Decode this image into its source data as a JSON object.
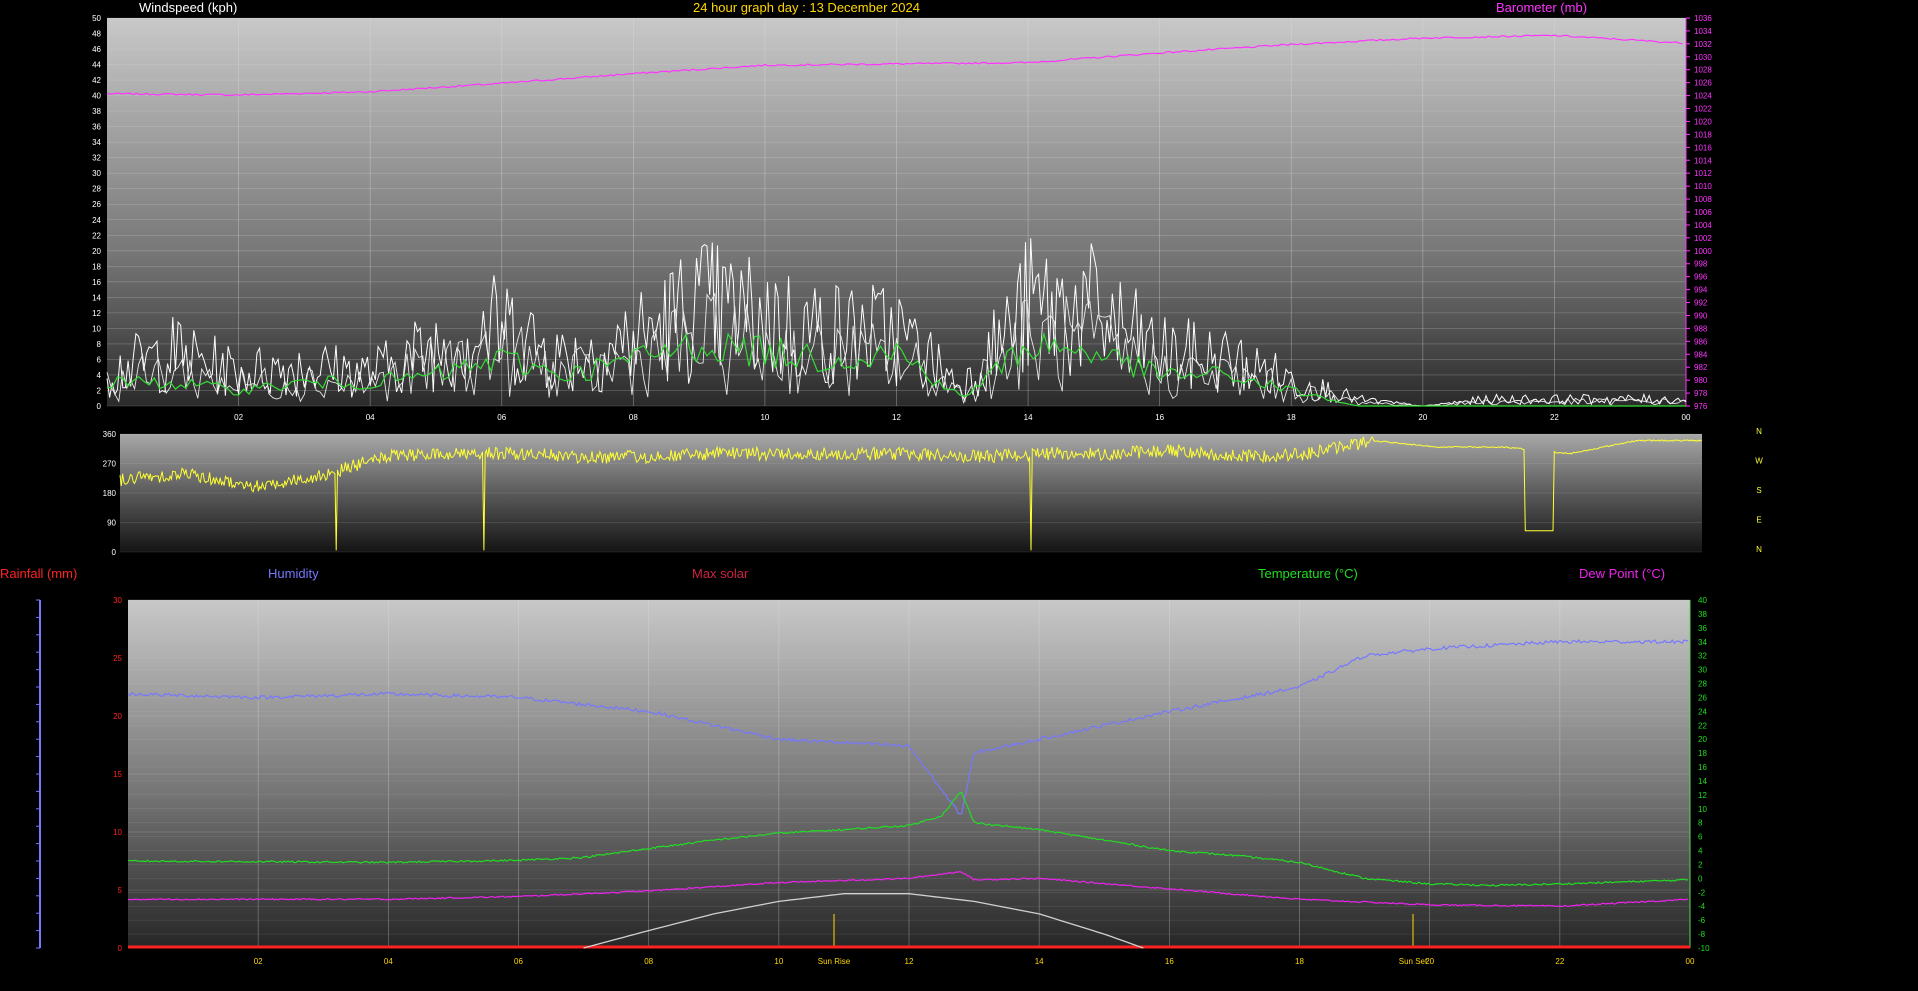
{
  "header": {
    "title": "24 hour graph day : 13 December 2024",
    "wind_label": "Windspeed (kph)",
    "baro_label": "Barometer (mb)"
  },
  "legend": {
    "rainfall": "Rainfall (mm)",
    "humidity": "Humidity",
    "max_solar": "Max solar",
    "temperature": "Temperature (°C)",
    "dew_point": "Dew Point (°C)"
  },
  "annotations": {
    "sun_rise": "Sun Rise",
    "sun_set": "Sun Set"
  },
  "colors": {
    "title": "#ffd700",
    "wind_gust": "#ffffff",
    "wind_avg": "#33dd33",
    "barometer": "#ff33ff",
    "wind_dir": "#ffff33",
    "rain": "#ff2222",
    "humidity": "#7777ff",
    "max_solar": "#cc2244",
    "temperature": "#22dd22",
    "dew_point": "#ee22ee",
    "solar_curve": "#d0d0d0"
  },
  "chart_data": [
    {
      "type": "line",
      "name": "wind-barometer",
      "x_ticks": [
        "02",
        "04",
        "06",
        "08",
        "10",
        "12",
        "14",
        "16",
        "18",
        "20",
        "22",
        "00"
      ],
      "y_left": {
        "label": "Windspeed (kph)",
        "min": 0,
        "max": 50,
        "step": 2
      },
      "y_right": {
        "label": "Barometer (mb)",
        "min": 976,
        "max": 1036,
        "step": 2
      },
      "series": [
        {
          "name": "Barometer (mb)",
          "axis": "right",
          "x": [
            0,
            2,
            4,
            6,
            8,
            10,
            12,
            14,
            16,
            18,
            20,
            22,
            24
          ],
          "values": [
            1024.3,
            1024.1,
            1024.6,
            1025.9,
            1027.4,
            1028.7,
            1028.9,
            1029.1,
            1030.6,
            1031.9,
            1032.9,
            1033.3,
            1032.1
          ]
        },
        {
          "name": "Windspeed (kph)",
          "axis": "left",
          "x": [
            0,
            1,
            2,
            3,
            4,
            5,
            6,
            7,
            8,
            9,
            10,
            11,
            12,
            13,
            14,
            15,
            16,
            17,
            18,
            19,
            20,
            21,
            22,
            23,
            24
          ],
          "values": [
            5,
            8,
            5,
            6,
            5,
            9,
            12,
            7,
            10,
            15,
            13,
            11,
            11,
            3,
            15,
            14,
            8,
            7,
            4,
            1,
            0,
            1,
            1,
            1,
            1
          ]
        },
        {
          "name": "Average windspeed",
          "axis": "left",
          "x": [
            0,
            1,
            2,
            3,
            4,
            5,
            6,
            7,
            8,
            9,
            10,
            11,
            12,
            13,
            14,
            15,
            16,
            17,
            18,
            19,
            20,
            21,
            22,
            23,
            24
          ],
          "values": [
            3,
            3,
            2,
            3,
            3,
            4,
            6,
            4,
            6,
            8,
            7,
            6,
            7,
            1,
            8,
            7,
            4,
            4,
            2,
            0,
            0,
            0,
            0,
            0,
            0
          ]
        }
      ]
    },
    {
      "type": "line",
      "name": "wind-direction",
      "x_ticks": [
        "02",
        "04",
        "06",
        "08",
        "10",
        "12",
        "14",
        "16",
        "18",
        "20",
        "22",
        "00"
      ],
      "y_ticks": [
        0,
        90,
        180,
        270,
        360
      ],
      "compass": [
        "N",
        "W",
        "S",
        "E",
        "N"
      ],
      "series": [
        {
          "name": "Wind direction",
          "x": [
            0,
            1,
            2,
            3,
            4,
            5,
            6,
            7,
            8,
            9,
            10,
            11,
            12,
            13,
            14,
            15,
            16,
            17,
            18,
            19,
            20,
            21,
            22,
            23,
            24
          ],
          "values": [
            220,
            240,
            200,
            230,
            290,
            300,
            300,
            290,
            290,
            300,
            300,
            300,
            300,
            290,
            300,
            300,
            310,
            290,
            300,
            340,
            320,
            320,
            300,
            340,
            340
          ]
        }
      ]
    },
    {
      "type": "line",
      "name": "temperature-humidity",
      "x_ticks": [
        "02",
        "04",
        "06",
        "08",
        "10",
        "12",
        "14",
        "16",
        "18",
        "20",
        "22",
        "00"
      ],
      "y_rain": {
        "label": "Rainfall (mm)",
        "min": 0,
        "max": 30,
        "ticks": [
          0,
          5,
          10,
          15,
          20,
          25,
          30
        ]
      },
      "y_temp": {
        "label": "Temperature (°C)",
        "min": -10,
        "max": 40,
        "step": 2
      },
      "series": [
        {
          "name": "Humidity",
          "axis": "temp",
          "x": [
            0,
            2,
            4,
            6,
            8,
            10,
            12,
            12.8,
            13,
            14,
            16,
            18,
            19,
            20,
            22,
            24
          ],
          "values": [
            26.5,
            26,
            26.5,
            26,
            24,
            20,
            19,
            9,
            18,
            20,
            24,
            27.5,
            32,
            33,
            34,
            34
          ]
        },
        {
          "name": "Temperature (°C)",
          "axis": "temp",
          "x": [
            0,
            2,
            4,
            6,
            7,
            8,
            9,
            10,
            11,
            12,
            12.5,
            12.8,
            13,
            14,
            15,
            16,
            17,
            18,
            19,
            20,
            21,
            22,
            23,
            24
          ],
          "values": [
            2.5,
            2.4,
            2.3,
            2.6,
            3,
            4.3,
            5.5,
            6.5,
            7,
            7.6,
            9,
            12.5,
            8,
            7,
            5.5,
            4,
            3.3,
            2.3,
            0,
            -0.8,
            -1,
            -0.8,
            -0.5,
            -0.2
          ]
        },
        {
          "name": "Dew Point (°C)",
          "axis": "temp",
          "x": [
            0,
            2,
            4,
            6,
            8,
            10,
            12,
            12.8,
            13,
            14,
            16,
            18,
            20,
            22,
            24
          ],
          "values": [
            -3,
            -3,
            -3,
            -2.6,
            -1.8,
            -0.6,
            0,
            1,
            -0.2,
            0,
            -1.5,
            -3,
            -3.8,
            -4,
            -3
          ]
        },
        {
          "name": "Max solar",
          "axis": "temp",
          "x": [
            7,
            8,
            9,
            10,
            11,
            12,
            13,
            14,
            15,
            15.6
          ],
          "values": [
            -10,
            -7.5,
            -5.1,
            -3.3,
            -2.2,
            -2.2,
            -3.3,
            -5.1,
            -8,
            -10
          ]
        },
        {
          "name": "Rainfall (mm)",
          "axis": "rain",
          "x": [
            0,
            24
          ],
          "values": [
            0,
            0
          ]
        }
      ]
    }
  ]
}
